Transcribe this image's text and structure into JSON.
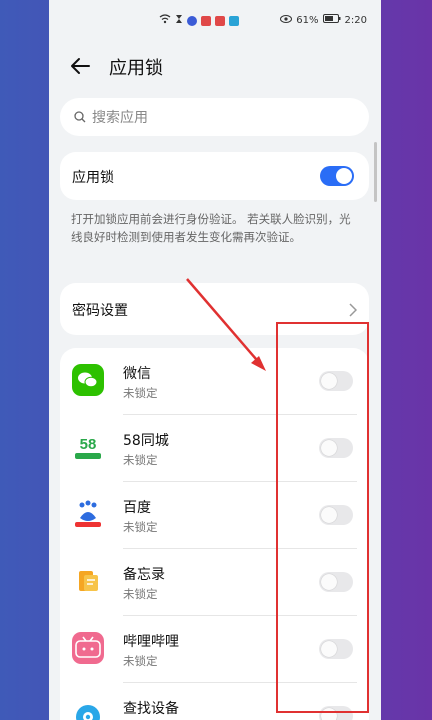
{
  "status_bar": {
    "battery": "61%",
    "time": "2:20"
  },
  "header": {
    "title": "应用锁"
  },
  "search": {
    "placeholder": "搜索应用"
  },
  "app_lock": {
    "label": "应用锁",
    "enabled": true
  },
  "description": "打开加锁应用前会进行身份验证。 若关联人脸识别，光线良好时检测到使用者发生变化需再次验证。",
  "password_settings": {
    "label": "密码设置"
  },
  "apps": [
    {
      "name": "微信",
      "status": "未锁定",
      "locked": false,
      "icon": "wechat-icon"
    },
    {
      "name": "58同城",
      "status": "未锁定",
      "locked": false,
      "icon": "58-icon"
    },
    {
      "name": "百度",
      "status": "未锁定",
      "locked": false,
      "icon": "baidu-icon"
    },
    {
      "name": "备忘录",
      "status": "未锁定",
      "locked": false,
      "icon": "notes-icon"
    },
    {
      "name": "哔哩哔哩",
      "status": "未锁定",
      "locked": false,
      "icon": "bilibili-icon"
    },
    {
      "name": "查找设备",
      "status": "",
      "locked": false,
      "icon": "find-device-icon"
    }
  ],
  "colors": {
    "accent": "#2a6df6",
    "annotation": "#e03131"
  }
}
